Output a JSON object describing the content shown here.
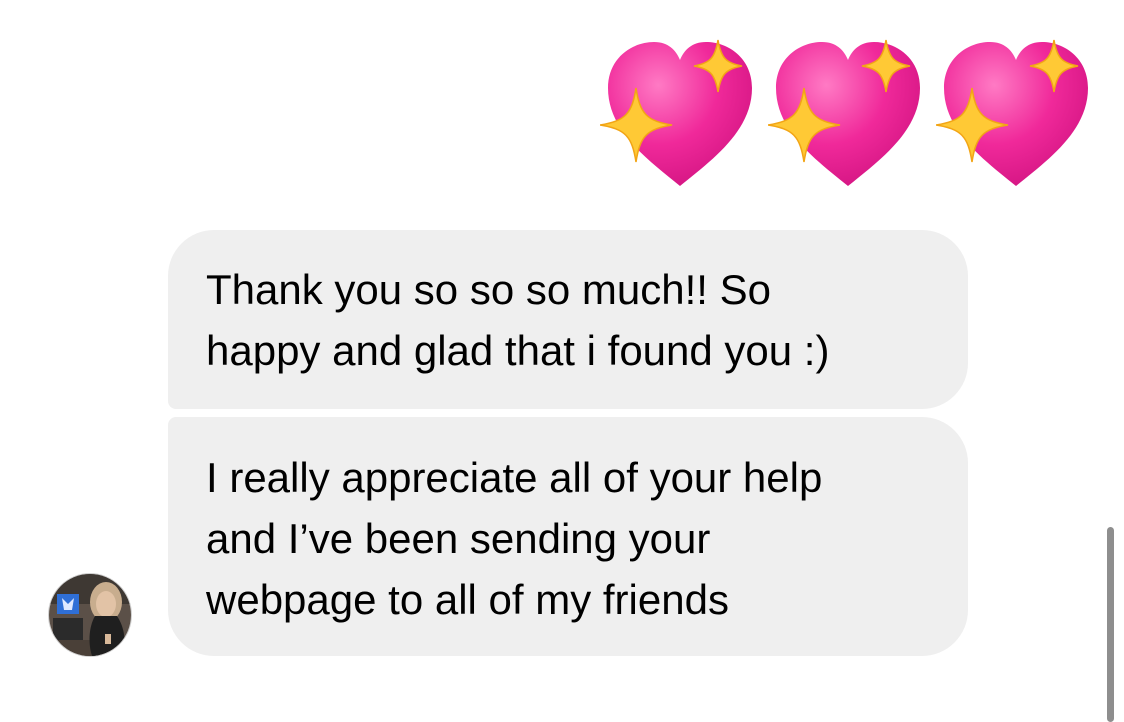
{
  "conversation": {
    "sent": {
      "emoji": [
        "sparkling-heart",
        "sparkling-heart",
        "sparkling-heart"
      ]
    },
    "received": [
      {
        "lines": [
          "Thank you so so so much!! So",
          "happy and glad that i found you :)"
        ]
      },
      {
        "lines": [
          "I really appreciate all of your help",
          "and I’ve been sending your",
          "webpage to all of my friends"
        ]
      }
    ]
  },
  "colors": {
    "received_bubble": "#efefef",
    "heart": "#ee2a95",
    "sparkle": "#ffc935",
    "scrollbar": "#8e8e8e"
  }
}
